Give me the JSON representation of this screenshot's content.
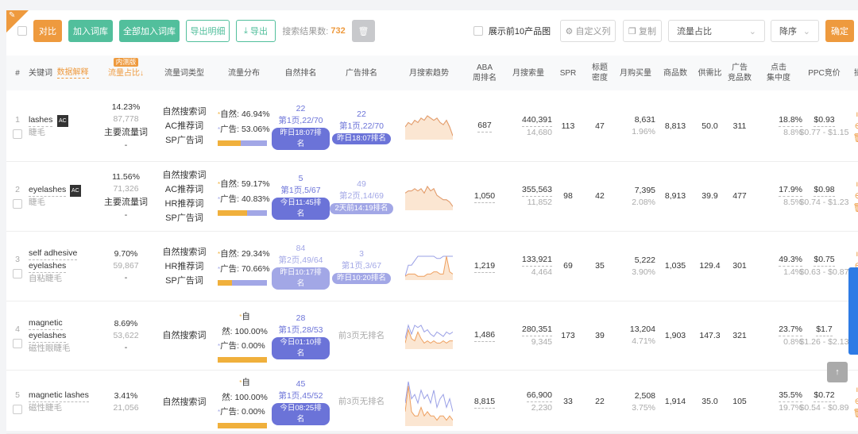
{
  "toolbar": {
    "compare": "对比",
    "add_lib": "加入词库",
    "add_all": "全部加入词库",
    "export_detail": "导出明细",
    "export": "导出",
    "result_label": "搜索结果数:",
    "result_count": "732",
    "show_top10": "展示前10产品图",
    "custom_cols": "自定义列",
    "copy": "复制",
    "sort_field": "流量占比",
    "sort_order": "降序",
    "confirm": "确定"
  },
  "header": {
    "idx": "#",
    "keyword": "关键词",
    "explain": "数据解释",
    "beta": "内测版",
    "share": "流量占比↓",
    "type": "流量词类型",
    "dist": "流量分布",
    "nat": "自然排名",
    "ad": "广告排名",
    "trend": "月搜索趋势",
    "aba": "ABA\n周排名",
    "msv": "月搜索量",
    "spr": "SPR",
    "density": "标题\n密度",
    "purchase": "月购买量",
    "goods": "商品数",
    "ratio": "供需比",
    "adcomp": "广告\n竞品数",
    "click": "点击\n集中度",
    "ppc": "PPC竞价",
    "op": "操"
  },
  "labels": {
    "nat": "自然:",
    "ad": "广告:"
  },
  "rows": [
    {
      "idx": "1",
      "kw": [
        "lashes"
      ],
      "ac": "AC",
      "cn": "睫毛",
      "share": "14.23%",
      "share_num": "87,778",
      "main": "主要流量词",
      "dash": "-",
      "types": [
        "自然搜索词",
        "AC推荐词",
        "SP广告词"
      ],
      "nat_pct": "46.94%",
      "ad_pct": "53.06%",
      "nat_frac": 0.4694,
      "nat_rank": "22",
      "nat_pos": "第1页,22/70",
      "nat_time": "昨日18:07排名",
      "nat_light": false,
      "ad_rank": "22",
      "ad_pos": "第1页,22/70",
      "ad_time": "昨日18:07排名",
      "ad_light": false,
      "aba": "687",
      "msv": "440,391",
      "msv2": "14,680",
      "spr": "113",
      "density": "47",
      "purchase": "8,631",
      "purchase_pct": "1.96%",
      "goods": "8,813",
      "ratio": "50.0",
      "adcomp": "311",
      "click": "18.8%",
      "click2": "8.8%",
      "ppc": "$0.93",
      "ppc_range": "$0.77 - $1.15",
      "trend_a": [
        5,
        7,
        6,
        8,
        7,
        9,
        8,
        10,
        9,
        8,
        9,
        7,
        6,
        8,
        5,
        1
      ],
      "trend_b": [
        5,
        7,
        6,
        8,
        7,
        9,
        8,
        10,
        9,
        8,
        9,
        7,
        6,
        8,
        5,
        1
      ]
    },
    {
      "idx": "2",
      "kw": [
        "eyelashes"
      ],
      "ac": "AC",
      "cn": "睫毛",
      "share": "11.56%",
      "share_num": "71,326",
      "main": "主要流量词",
      "dash": "-",
      "types": [
        "自然搜索词",
        "AC推荐词",
        "HR推荐词",
        "SP广告词"
      ],
      "nat_pct": "59.17%",
      "ad_pct": "40.83%",
      "nat_frac": 0.5917,
      "nat_rank": "5",
      "nat_pos": "第1页,5/67",
      "nat_time": "今日11:45排名",
      "nat_light": false,
      "ad_rank": "49",
      "ad_pos": "第2页,14/69",
      "ad_time": "2天前14:19排名",
      "ad_light": true,
      "aba": "1,050",
      "msv": "355,563",
      "msv2": "11,852",
      "spr": "98",
      "density": "42",
      "purchase": "7,395",
      "purchase_pct": "2.08%",
      "goods": "8,913",
      "ratio": "39.9",
      "adcomp": "477",
      "click": "17.9%",
      "click2": "8.5%",
      "ppc": "$0.98",
      "ppc_range": "$0.74 - $1.23",
      "trend_a": [
        7,
        8,
        8,
        9,
        8,
        9,
        7,
        10,
        8,
        9,
        6,
        5,
        4,
        4,
        3,
        1
      ],
      "trend_b": [
        7,
        8,
        8,
        9,
        8,
        9,
        7,
        10,
        8,
        9,
        6,
        5,
        4,
        4,
        3,
        1
      ]
    },
    {
      "idx": "3",
      "kw": [
        "self adhesive",
        "eyelashes"
      ],
      "ac": "",
      "cn": "自粘睫毛",
      "share": "9.70%",
      "share_num": "59,867",
      "main": "",
      "dash": "-",
      "types": [
        "自然搜索词",
        "HR推荐词",
        "SP广告词"
      ],
      "nat_pct": "29.34%",
      "ad_pct": "70.66%",
      "nat_frac": 0.2934,
      "nat_rank": "84",
      "nat_pos": "第2页,49/64",
      "nat_time": "昨日10:17排名",
      "nat_light": true,
      "ad_rank": "3",
      "ad_pos": "第1页,3/67",
      "ad_time": "昨日10:20排名",
      "ad_light": true,
      "aba": "1,219",
      "msv": "133,921",
      "msv2": "4,464",
      "spr": "69",
      "density": "35",
      "purchase": "5,222",
      "purchase_pct": "3.90%",
      "goods": "1,035",
      "ratio": "129.4",
      "adcomp": "301",
      "click": "49.3%",
      "click2": "1.4%",
      "ppc": "$0.75",
      "ppc_range": "$0.63 - $0.87",
      "trend_a": [
        1,
        2,
        2,
        2,
        1,
        1,
        1,
        2,
        2,
        3,
        3,
        2,
        2,
        10,
        3,
        2
      ],
      "trend_b": [
        1,
        6,
        6,
        8,
        10,
        10,
        10,
        10,
        10,
        10,
        9,
        9,
        10,
        10,
        10,
        10
      ]
    },
    {
      "idx": "4",
      "kw": [
        "magnetic",
        "eyelashes"
      ],
      "ac": "",
      "cn": "磁性眼睫毛",
      "share": "8.69%",
      "share_num": "53,622",
      "main": "",
      "dash": "-",
      "types": [
        "自然搜索词"
      ],
      "nat_pct": "100.00%",
      "ad_pct": "0.00%",
      "nat_frac": 1,
      "nat_rank": "28",
      "nat_pos": "第1页,28/53",
      "nat_time": "今日01:10排名",
      "nat_light": false,
      "ad_none": "前3页无排名",
      "aba": "1,486",
      "msv": "280,351",
      "msv2": "9,345",
      "spr": "173",
      "density": "39",
      "purchase": "13,204",
      "purchase_pct": "4.71%",
      "goods": "1,903",
      "ratio": "147.3",
      "adcomp": "321",
      "click": "23.7%",
      "click2": "0.8%",
      "ppc": "$1.7",
      "ppc_range": "$1.26 - $2.13",
      "trend_a": [
        2,
        8,
        4,
        3,
        7,
        4,
        2,
        3,
        2,
        3,
        2,
        2,
        3,
        2,
        3,
        3
      ],
      "trend_b": [
        4,
        10,
        6,
        10,
        9,
        10,
        7,
        8,
        6,
        5,
        7,
        6,
        5,
        7,
        6,
        7
      ]
    },
    {
      "idx": "5",
      "kw": [
        "magnetic lashes"
      ],
      "ac": "",
      "cn": "磁性睫毛",
      "share": "3.41%",
      "share_num": "21,056",
      "main": "",
      "dash": "",
      "types": [
        "自然搜索词"
      ],
      "nat_pct": "100.00%",
      "ad_pct": "0.00%",
      "nat_frac": 1,
      "nat_rank": "45",
      "nat_pos": "第1页,45/52",
      "nat_time": "今日08:25排名",
      "nat_light": false,
      "ad_none": "前3页无排名",
      "aba": "8,815",
      "msv": "66,900",
      "msv2": "2,230",
      "spr": "33",
      "density": "22",
      "purchase": "2,508",
      "purchase_pct": "3.75%",
      "goods": "1,914",
      "ratio": "35.0",
      "adcomp": "105",
      "click": "35.5%",
      "click2": "19.7%",
      "ppc": "$0.72",
      "ppc_range": "$0.54 - $0.89",
      "trend_a": [
        3,
        9,
        3,
        2,
        2,
        4,
        2,
        3,
        2,
        2,
        1,
        2,
        2,
        1,
        2,
        1
      ],
      "trend_b": [
        5,
        10,
        6,
        7,
        5,
        8,
        6,
        7,
        5,
        8,
        4,
        6,
        7,
        4,
        6,
        3
      ]
    }
  ],
  "colors": {
    "orange": "#ee9a3e",
    "green": "#52bf9c",
    "blue": "#6b73d8",
    "lightblue": "#a2a7e6"
  }
}
